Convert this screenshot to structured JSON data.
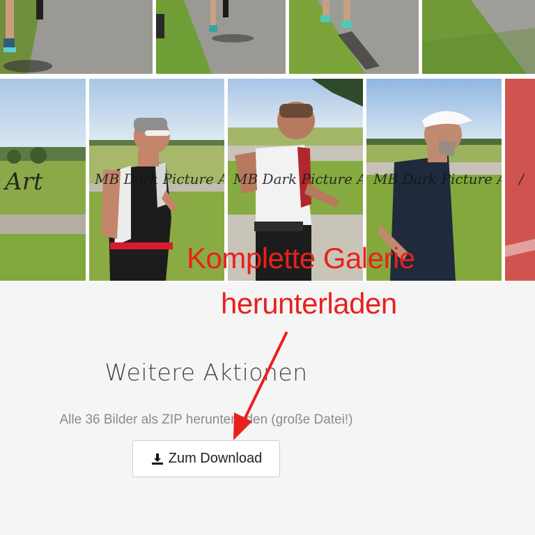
{
  "gallery": {
    "watermark": "MB Dark Picture Art",
    "image_count": 36
  },
  "annotation": {
    "line1": "Komplette Galerie",
    "line2": "herunterladen",
    "color": "#e8211c"
  },
  "actions": {
    "title": "Weitere Aktionen",
    "zip_text": "Alle 36 Bilder als ZIP herunterladen (große Datei!)",
    "download_label": "Zum Download",
    "download_icon": "download-icon"
  },
  "colors": {
    "background": "#f5f5f5",
    "button_border": "#cfcfcf",
    "muted_text": "#8a8a8a"
  }
}
